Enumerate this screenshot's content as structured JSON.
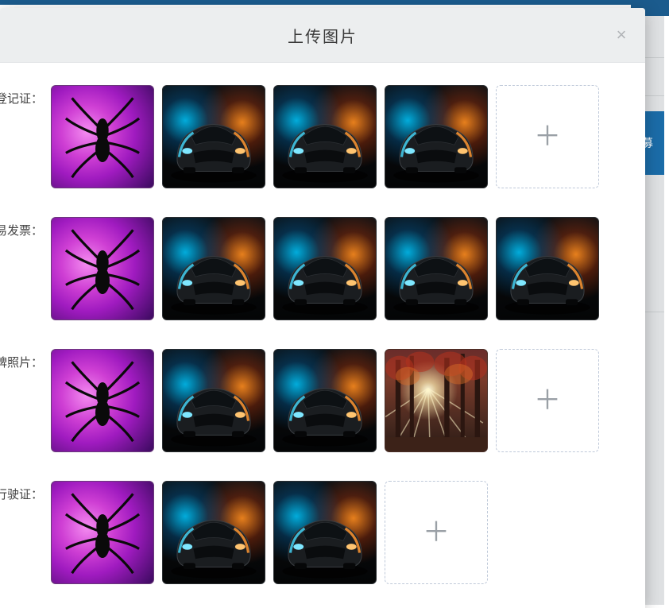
{
  "modal": {
    "title": "上传图片",
    "close_label": "×"
  },
  "rows": [
    {
      "label": "登记证：",
      "images": [
        "spider",
        "car",
        "car",
        "car"
      ],
      "show_add": true
    },
    {
      "label": "易发票：",
      "images": [
        "spider",
        "car",
        "car",
        "car",
        "car"
      ],
      "show_add": false
    },
    {
      "label": "牌照片：",
      "images": [
        "spider",
        "car",
        "car",
        "forest"
      ],
      "show_add": true
    },
    {
      "label": "行驶证：",
      "images": [
        "spider",
        "car",
        "car"
      ],
      "show_add": true
    }
  ],
  "background": {
    "right_button_label": "募"
  },
  "add_button_symbol": "＋"
}
